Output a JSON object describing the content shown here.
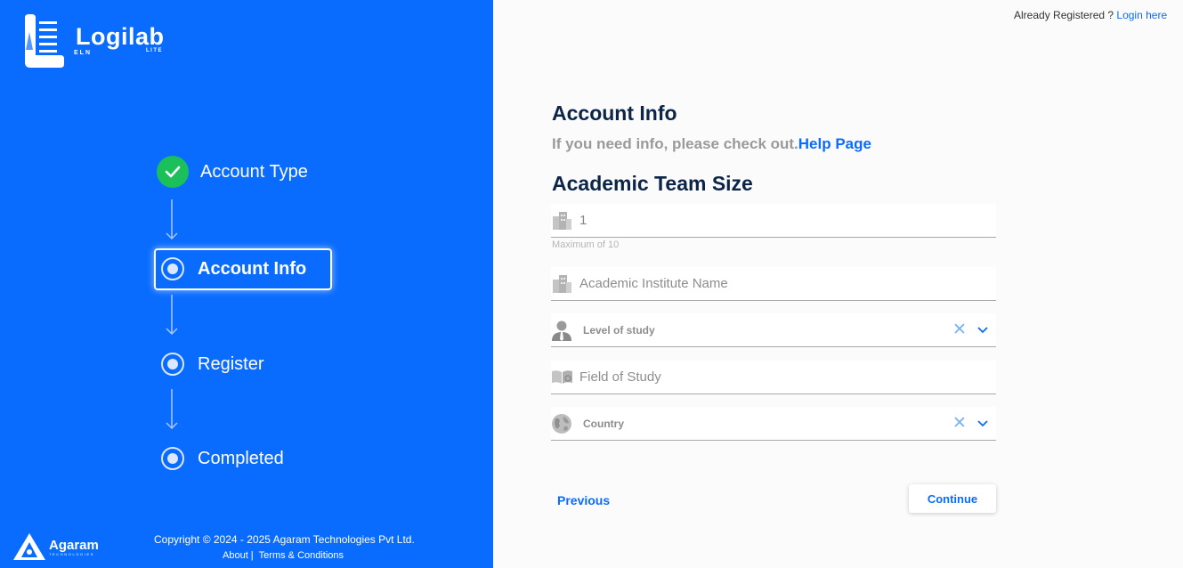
{
  "brand": {
    "name": "Logilab",
    "sub_left": "ELN",
    "sub_right": "LITE"
  },
  "steps": [
    {
      "label": "Account Type",
      "state": "done"
    },
    {
      "label": "Account Info",
      "state": "active"
    },
    {
      "label": "Register",
      "state": "pending"
    },
    {
      "label": "Completed",
      "state": "pending"
    }
  ],
  "footer": {
    "company": "Agaram",
    "company_sub": "TECHNOLOGIES",
    "copyright": "Copyright © 2024 - 2025 Agaram Technologies Pvt Ltd.",
    "about": "About |",
    "terms": "Terms & Conditions"
  },
  "header": {
    "already_text": "Already Registered ?",
    "login_link": "Login here"
  },
  "form": {
    "title": "Account Info",
    "subtitle": "If you need info, please check out.",
    "help_link": "Help Page",
    "section_title": "Academic Team Size",
    "team_size_value": "1",
    "team_size_hint": "Maximum of 10",
    "institute_placeholder": "Academic Institute Name",
    "level_placeholder": "Level of study",
    "field_placeholder": "Field of Study",
    "country_placeholder": "Country",
    "clear_symbol": "✕",
    "previous_label": "Previous",
    "continue_label": "Continue"
  },
  "colors": {
    "primary": "#0a6cff",
    "success": "#1cc05a",
    "heading": "#0b2447"
  }
}
